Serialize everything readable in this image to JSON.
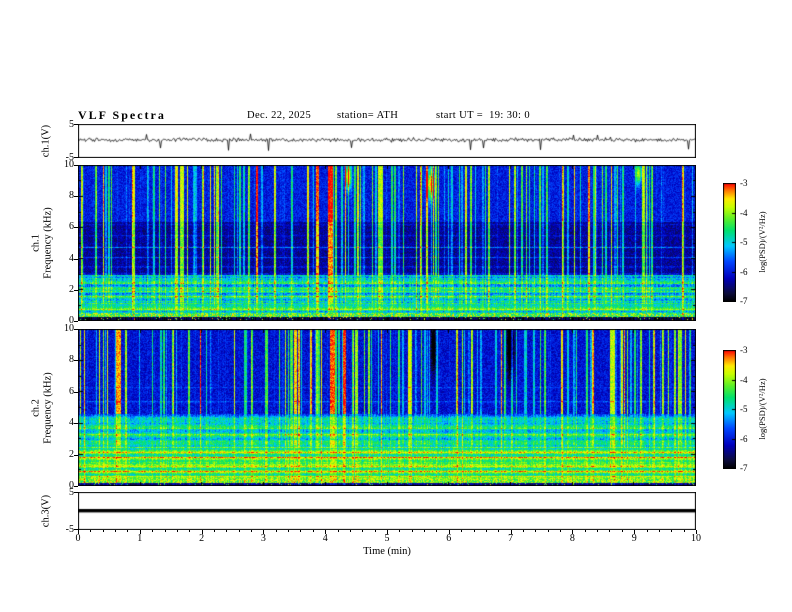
{
  "header": {
    "title": "VLF Spectra",
    "date": "Dec. 22, 2025",
    "station": "station= ATH",
    "start_ut": "start UT =  19: 30: 0"
  },
  "panels": {
    "wave1": {
      "label": "ch.1(V)",
      "ytop": "5",
      "ybottom": "-5"
    },
    "spec1": {
      "label_ch": "ch.1",
      "label_freq": "Frequency (kHz)",
      "yticks": [
        "10",
        "8",
        "6",
        "4",
        "2",
        "0"
      ]
    },
    "spec2": {
      "label_ch": "ch.2",
      "label_freq": "Frequency (kHz)",
      "yticks": [
        "10",
        "8",
        "6",
        "4",
        "2",
        "0"
      ]
    },
    "wave3": {
      "label": "ch.3(V)",
      "ytop": "5",
      "ybottom": "-5"
    }
  },
  "xaxis": {
    "label": "Time (min)",
    "ticks": [
      "0",
      "1",
      "2",
      "3",
      "4",
      "5",
      "6",
      "7",
      "8",
      "9",
      "10"
    ]
  },
  "colorbar": {
    "label": "log(PSD)/(V²/Hz)",
    "ticks": [
      "-3",
      "-4",
      "-5",
      "-6",
      "-7"
    ]
  },
  "chart_data": [
    {
      "type": "line",
      "name": "ch1_waveform",
      "ylabel": "ch.1(V)",
      "xlabel": "Time (min)",
      "xlim": [
        0,
        10
      ],
      "ylim": [
        -5,
        5
      ],
      "description": "Continuous noisy voltage trace centered near 0 V with dense small fluctuations (~±1 V) and sporadic impulsive spikes reaching about +3 V and -4 V across the whole 10-minute record."
    },
    {
      "type": "heatmap",
      "name": "ch1_spectrogram",
      "ylabel": "Frequency (kHz)",
      "xlabel": "Time (min)",
      "xlim": [
        0,
        10
      ],
      "ylim": [
        0,
        10
      ],
      "zlim": [
        -7,
        -3
      ],
      "zlabel": "log(PSD)/(V²/Hz)",
      "colormap": "jet with black floor",
      "x_ticks": [
        0,
        1,
        2,
        3,
        4,
        5,
        6,
        7,
        8,
        9,
        10
      ],
      "y_ticks": [
        0,
        2,
        4,
        6,
        8,
        10
      ],
      "features": [
        "0-0.4 kHz: very low power black band with sporadic red/orange speckles",
        "0.4-3 kHz: enhanced power (green/yellow) with many narrow horizontal interference lines",
        "3-6.5 kHz: weakest broadband region (dark blue)",
        "6.5-10 kHz: moderate power (blue) crossed by dense vertical sferic streaks (cyan/green)",
        "occasional strong transients reaching orange/red near 9-10 kHz"
      ]
    },
    {
      "type": "heatmap",
      "name": "ch2_spectrogram",
      "ylabel": "Frequency (kHz)",
      "xlabel": "Time (min)",
      "xlim": [
        0,
        10
      ],
      "ylim": [
        0,
        10
      ],
      "zlim": [
        -7,
        -3
      ],
      "zlabel": "log(PSD)/(V²/Hz)",
      "colormap": "jet with black floor",
      "x_ticks": [
        0,
        1,
        2,
        3,
        4,
        5,
        6,
        7,
        8,
        9,
        10
      ],
      "y_ticks": [
        0,
        2,
        4,
        6,
        8,
        10
      ],
      "features": [
        "0-0.3 kHz: low power dark band",
        "0.3-2.5 kHz: strong power (green/yellow) with dense horizontal interference lines",
        "2.5-4.5 kHz: moderate green power with striping",
        "4.5-10 kHz: low power (blue) with vertical sferic streaks and darker gaps near 5.5-7 min"
      ]
    },
    {
      "type": "line",
      "name": "ch3_waveform",
      "ylabel": "ch.3(V)",
      "xlabel": "Time (min)",
      "xlim": [
        0,
        10
      ],
      "ylim": [
        -5,
        5
      ],
      "description": "Flat thick black line at 0 V for the entire interval (no signal on channel 3)."
    }
  ]
}
